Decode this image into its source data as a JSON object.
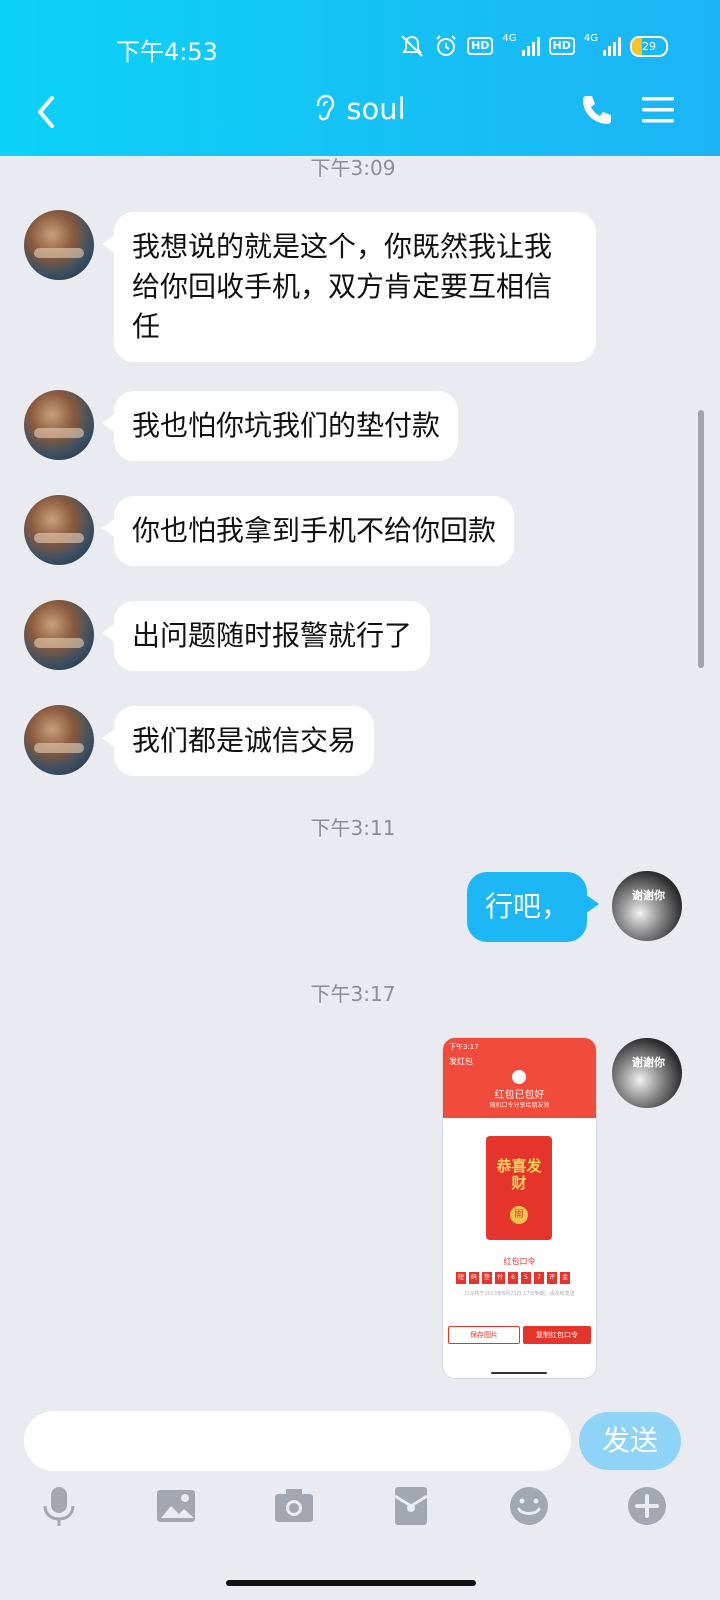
{
  "status_bar": {
    "time": "下午4:53",
    "hd1": "HD",
    "net1": "4G",
    "hd2": "HD",
    "net2": "4G",
    "battery": "29",
    "battery_level": 0.29
  },
  "header": {
    "title": "soul",
    "back_icon": "chevron-left-icon",
    "title_icon": "ear-icon",
    "phone_icon": "phone-icon",
    "menu_icon": "menu-icon"
  },
  "messages": {
    "ts1": "下午3:09",
    "m1": "我想说的就是这个，你既然我让我给你回收手机，双方肯定要互相信任",
    "m2": "我也怕你坑我们的垫付款",
    "m3": "你也怕我拿到手机不给你回款",
    "m4": "出问题随时报警就行了",
    "m5": "我们都是诚信交易",
    "ts2": "下午3:11",
    "m6": "行吧，",
    "ts3": "下午3:17",
    "avatar_right_text": "谢谢你"
  },
  "image_message": {
    "status_time": "下午3:17",
    "nav_title": "发红包",
    "heading": "红包已包好",
    "sub": "随机口令分享给朋友领",
    "envelope_text": "恭喜发财",
    "open_text": "開",
    "command_title": "红包口令",
    "command_chars": [
      "短",
      "码",
      "垫",
      "付",
      "6",
      "5",
      "7",
      "评",
      "金"
    ],
    "note": "口令将于2023年6月21日 17日到期，请及时发送",
    "save_button": "保存图片",
    "copy_button": "复制红包口令"
  },
  "input": {
    "placeholder": "",
    "send_label": "发送"
  },
  "toolbar": {
    "icons": [
      "microphone-icon",
      "image-icon",
      "camera-icon",
      "red-envelope-icon",
      "emoji-icon",
      "plus-icon"
    ]
  },
  "colors": {
    "header_gradient_start": "#0bd3f7",
    "header_gradient_end": "#1cb4f5",
    "bubble_right": "#1db7f5",
    "background": "#e9ebf1",
    "send_button": "#8fd4f7",
    "toolbar_icon": "#a3a7b0"
  }
}
